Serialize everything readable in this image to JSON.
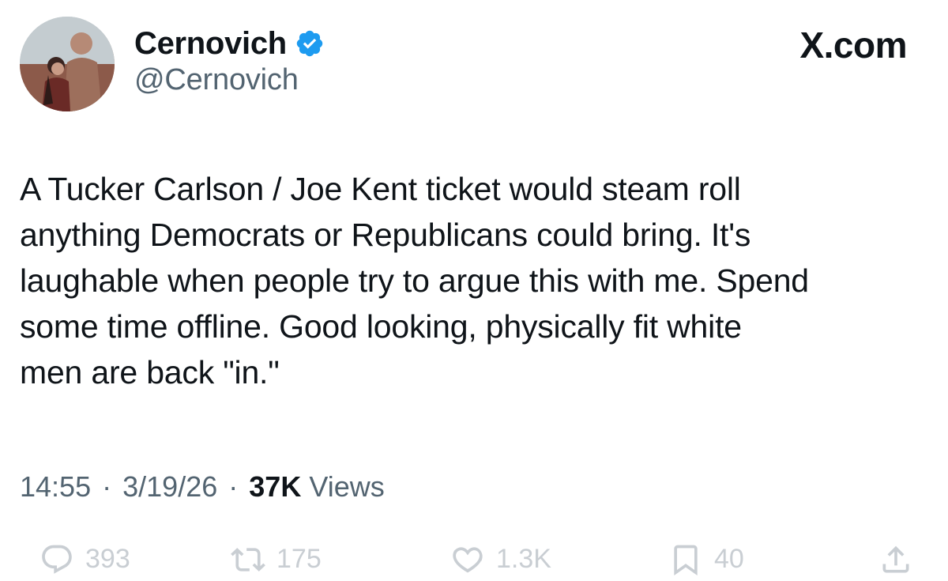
{
  "author": {
    "name": "Cernovich",
    "handle": "@Cernovich",
    "verified": true
  },
  "brand": "X.com",
  "tweet": {
    "text": "A Tucker Carlson / Joe Kent ticket would steam roll\nanything Democrats or Republicans could bring. It's\nlaughable when people try to argue this with me. Spend\nsome time offline. Good looking, physically fit white\nmen are back \"in.\""
  },
  "meta": {
    "time": "14:55",
    "separator": "·",
    "date": "3/19/26",
    "views_count": "37K",
    "views_label": "Views"
  },
  "actions": {
    "replies": "393",
    "reposts": "175",
    "likes": "1.3K",
    "bookmarks": "40"
  },
  "colors": {
    "text": "#0f1419",
    "secondary": "#536471",
    "verified": "#1d9bf0",
    "action_faded": "#c9ced3"
  },
  "icons": {
    "verified": "verified-badge-icon",
    "reply": "reply-icon",
    "repost": "repost-icon",
    "like": "heart-icon",
    "bookmark": "bookmark-icon",
    "share": "share-icon"
  }
}
